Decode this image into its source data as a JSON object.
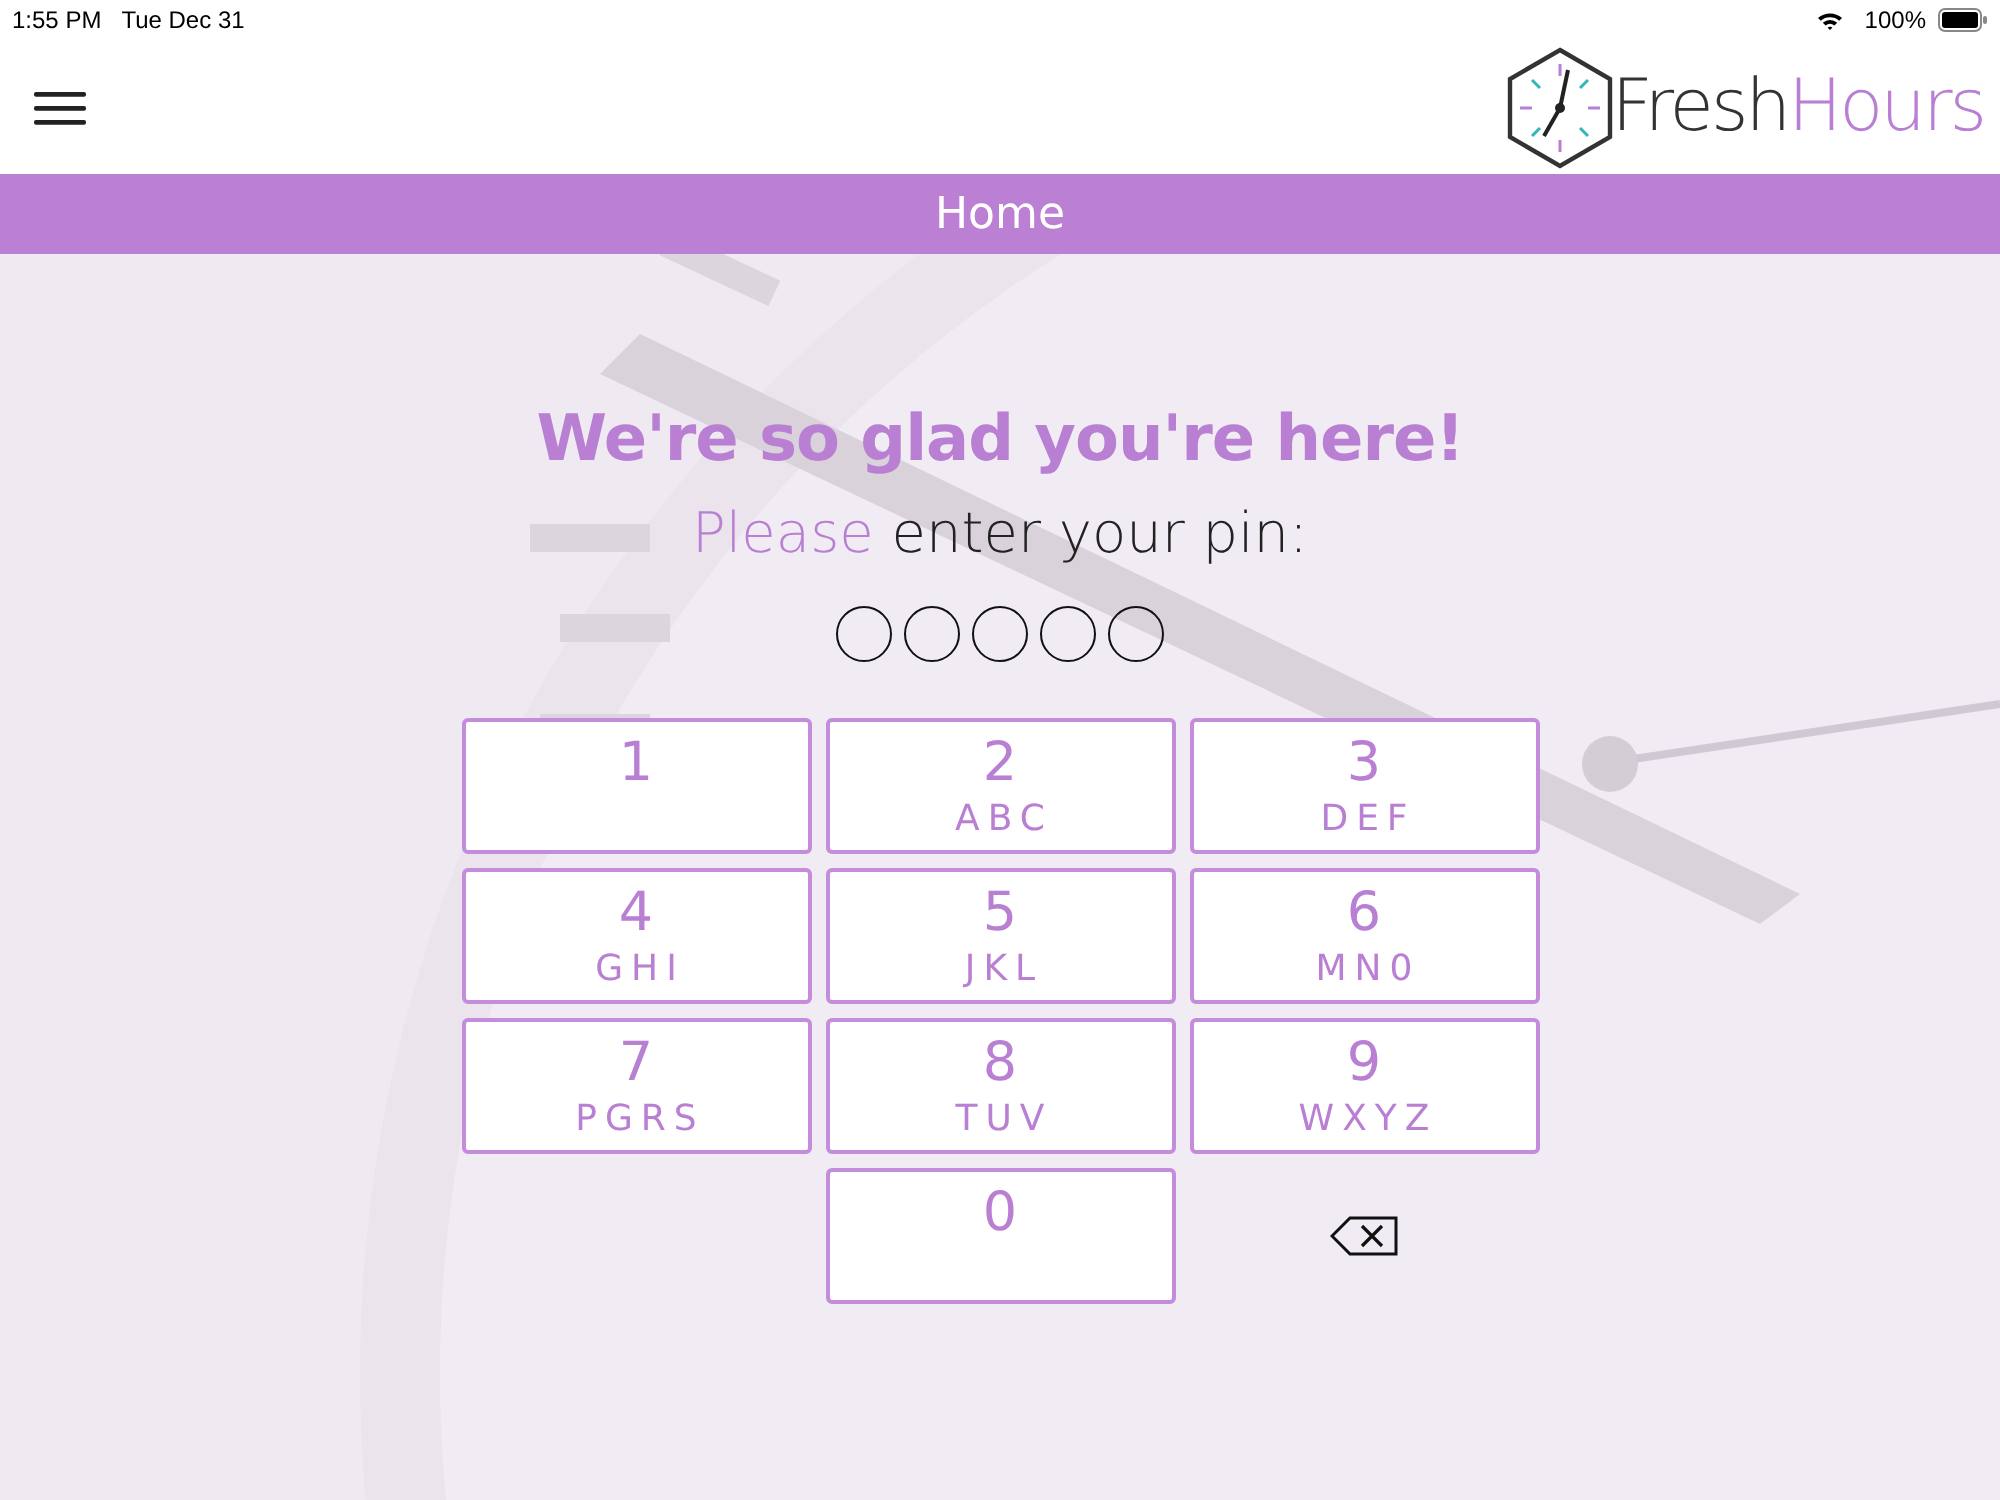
{
  "status_bar": {
    "time": "1:55 PM",
    "date": "Tue Dec 31",
    "battery": "100%"
  },
  "header": {
    "logo": {
      "first": "Fresh",
      "second": "Hours"
    }
  },
  "nav_bar": {
    "title": "Home"
  },
  "greeting": "We're so glad you're here!",
  "prompt": {
    "highlight": "Please",
    "rest": "enter your pin:"
  },
  "pin_dots": [
    {
      "filled": false
    },
    {
      "filled": false
    },
    {
      "filled": false
    },
    {
      "filled": false
    },
    {
      "filled": false
    }
  ],
  "keys": [
    {
      "kind": "digit",
      "digit": "1"
    },
    {
      "kind": "digit",
      "digit": "2",
      "letters": "ABC"
    },
    {
      "kind": "digit",
      "digit": "3",
      "letters": "DEF"
    },
    {
      "kind": "digit",
      "digit": "4",
      "letters": "GHI"
    },
    {
      "kind": "digit",
      "digit": "5",
      "letters": "JKL"
    },
    {
      "kind": "digit",
      "digit": "6",
      "letters": "MN0"
    },
    {
      "kind": "digit",
      "digit": "7",
      "letters": "PGRS"
    },
    {
      "kind": "digit",
      "digit": "8",
      "letters": "TUV"
    },
    {
      "kind": "digit",
      "digit": "9",
      "letters": "WXYZ"
    },
    {
      "kind": "blank"
    },
    {
      "kind": "digit",
      "digit": "0"
    },
    {
      "kind": "backspace"
    }
  ]
}
